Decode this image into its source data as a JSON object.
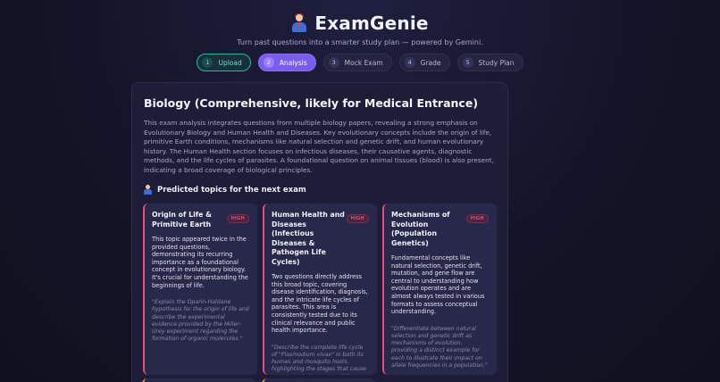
{
  "app": {
    "title": "ExamGenie",
    "subtitle": "Turn past questions into a smarter study plan — powered by Gemini."
  },
  "steps": [
    {
      "num": "1",
      "label": "Upload",
      "state": "done"
    },
    {
      "num": "2",
      "label": "Analysis",
      "state": "active"
    },
    {
      "num": "3",
      "label": "Mock Exam",
      "state": "pending"
    },
    {
      "num": "4",
      "label": "Grade",
      "state": "pending"
    },
    {
      "num": "5",
      "label": "Study Plan",
      "state": "pending"
    }
  ],
  "analysis": {
    "title": "Biology (Comprehensive, likely for Medical Entrance)",
    "summary": "This exam analysis integrates questions from multiple biology papers, revealing a strong emphasis on Evolutionary Biology and Human Health and Diseases. Key evolutionary concepts include the origin of life, primitive Earth conditions, mechanisms like natural selection and genetic drift, and human evolutionary history. The Human Health section focuses on infectious diseases, their causative agents, diagnostic methods, and the life cycles of parasites. A foundational question on animal tissues (blood) is also present, indicating a broad coverage of biological principles.",
    "predicted_heading": "Predicted topics for the next exam",
    "topics": [
      {
        "title": "Origin of Life & Primitive Earth",
        "priority": "HIGH",
        "description": "This topic appeared twice in the provided questions, demonstrating its recurring importance as a foundational concept in evolutionary biology. It's crucial for understanding the beginnings of life.",
        "sample_question": "\"Explain the Oparin-Haldane hypothesis for the origin of life and describe the experimental evidence provided by the Miller-Urey experiment regarding the formation of organic molecules.\""
      },
      {
        "title": "Human Health and Diseases (Infectious Diseases & Pathogen Life Cycles)",
        "priority": "HIGH",
        "description": "Two questions directly address this broad topic, covering disease identification, diagnosis, and the intricate life cycles of parasites. This area is consistently tested due to its clinical relevance and public health importance.",
        "sample_question": "\"Describe the complete life cycle of \"Plasmodium vivax\" in both its human and mosquito hosts, highlighting the stages that cause symptoms in humans and the methods of prevention.\""
      },
      {
        "title": "Mechanisms of Evolution (Population Genetics)",
        "priority": "HIGH",
        "description": "Fundamental concepts like natural selection, genetic drift, mutation, and gene flow are central to understanding how evolution operates and are almost always tested in various formats to assess conceptual understanding.",
        "sample_question": "\"Differentiate between natural selection and genetic drift as mechanisms of evolution, providing a distinct example for each to illustrate their impact on allele frequencies in a population.\""
      }
    ]
  },
  "colors": {
    "accent": "#7b5cf0",
    "done": "#2bb5a1",
    "high_border": "#e6507a",
    "peek_border": "#e8a23a"
  }
}
